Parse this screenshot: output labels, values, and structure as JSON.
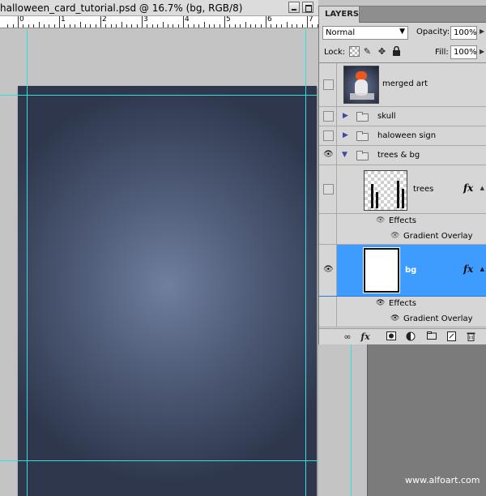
{
  "document": {
    "title": "halloween_card_tutorial.psd @ 16.7% (bg, RGB/8)",
    "ruler_numbers": [
      "0",
      "1",
      "2",
      "3",
      "4",
      "5",
      "6",
      "7"
    ]
  },
  "layers_panel": {
    "tab_label": "LAYERS",
    "blend_mode": "Normal",
    "opacity_label": "Opacity:",
    "opacity_value": "100%",
    "lock_label": "Lock:",
    "fill_label": "Fill:",
    "fill_value": "100%",
    "layers": {
      "merged": {
        "name": "merged art",
        "visible": false
      },
      "skull": {
        "name": "skull",
        "visible": false
      },
      "halo": {
        "name": "haloween sign",
        "visible": false
      },
      "trees_bg": {
        "name": "trees & bg",
        "visible": true
      },
      "trees": {
        "name": "trees",
        "visible": false,
        "effects_label": "Effects",
        "effect": "Gradient Overlay"
      },
      "bg": {
        "name": "bg",
        "visible": true,
        "selected": true,
        "effects_label": "Effects",
        "effect": "Gradient Overlay"
      }
    },
    "icons": {
      "eye": "eye-icon",
      "fx": "fx",
      "footer": [
        "link-icon",
        "fx-icon",
        "mask-icon",
        "adjustment-icon",
        "group-icon",
        "new-layer-icon",
        "trash-icon"
      ]
    }
  },
  "watermark": "www.alfoart.com"
}
